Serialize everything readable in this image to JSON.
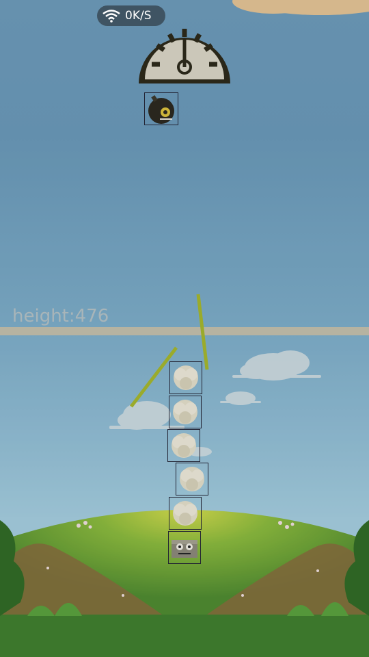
{
  "status": {
    "network_speed": "0K/S"
  },
  "hud": {
    "height_label": "height:476"
  },
  "game": {
    "hero": "bomb-hero-icon",
    "tower_blocks": [
      "cotton-block",
      "cotton-block",
      "cotton-block",
      "cotton-block",
      "cotton-block",
      "angry-base-block"
    ]
  },
  "colors": {
    "sky": "#6e9cbc",
    "grass": "#4f8c2d",
    "height_line": "#c7c2ad",
    "stick": "#a8b92a"
  }
}
